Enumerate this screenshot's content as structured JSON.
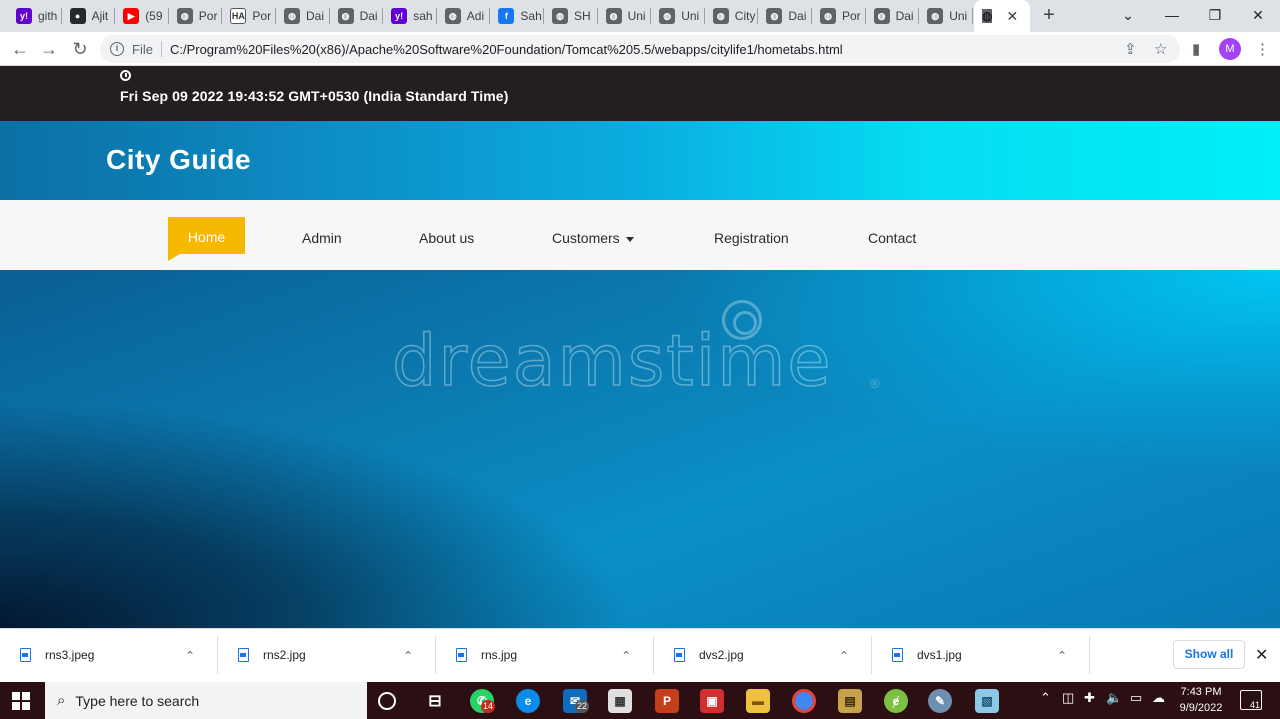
{
  "browser": {
    "tabs": [
      {
        "label": "gith",
        "icon": "yahoo-icon",
        "color": "#5f01d1",
        "glyph": "y!"
      },
      {
        "label": "Ajit",
        "icon": "github-icon",
        "color": "#24292e",
        "glyph": "●"
      },
      {
        "label": "(59",
        "icon": "youtube-icon",
        "color": "#ff0000",
        "glyph": "▶"
      },
      {
        "label": "Por",
        "icon": "globe-icon",
        "color": "#5f6368",
        "glyph": "◍"
      },
      {
        "label": "Por",
        "icon": "ha-icon",
        "color": "#ffffff",
        "glyph": "HA"
      },
      {
        "label": "Dai",
        "icon": "globe-icon",
        "color": "#5f6368",
        "glyph": "◍"
      },
      {
        "label": "Dai",
        "icon": "globe-icon",
        "color": "#5f6368",
        "glyph": "◍"
      },
      {
        "label": "sah",
        "icon": "yahoo-icon",
        "color": "#5f01d1",
        "glyph": "y!"
      },
      {
        "label": "Adi",
        "icon": "globe-icon",
        "color": "#5f6368",
        "glyph": "◍"
      },
      {
        "label": "Sah",
        "icon": "facebook-icon",
        "color": "#1877f2",
        "glyph": "f"
      },
      {
        "label": "SH",
        "icon": "globe-icon",
        "color": "#5f6368",
        "glyph": "◍"
      },
      {
        "label": "Uni",
        "icon": "globe-icon",
        "color": "#5f6368",
        "glyph": "◍"
      },
      {
        "label": "Uni",
        "icon": "globe-icon",
        "color": "#5f6368",
        "glyph": "◍"
      },
      {
        "label": "City",
        "icon": "globe-icon",
        "color": "#5f6368",
        "glyph": "◍"
      },
      {
        "label": "Dai",
        "icon": "globe-icon",
        "color": "#5f6368",
        "glyph": "◍"
      },
      {
        "label": "Por",
        "icon": "globe-icon",
        "color": "#5f6368",
        "glyph": "◍"
      },
      {
        "label": "Dai",
        "icon": "globe-icon",
        "color": "#5f6368",
        "glyph": "◍"
      },
      {
        "label": "Uni",
        "icon": "globe-icon",
        "color": "#5f6368",
        "glyph": "◍"
      }
    ],
    "active_tab_close": "✕",
    "new_tab": "+",
    "file_label": "File",
    "url": "C:/Program%20Files%20(x86)/Apache%20Software%20Foundation/Tomcat%205.5/webapps/citylife1/hometabs.html",
    "profile_initial": "M"
  },
  "page": {
    "datetime": "Fri Sep 09 2022 19:43:52 GMT+0530 (India Standard Time)",
    "brand": "City Guide",
    "nav": {
      "home": "Home",
      "admin": "Admin",
      "about": "About us",
      "customers": "Customers",
      "registration": "Registration",
      "contact": "Contact"
    },
    "watermark": "dreamstime",
    "watermark_reg": "®"
  },
  "downloads": {
    "files": [
      "rns3.jpeg",
      "rns2.jpg",
      "rns.jpg",
      "dvs2.jpg",
      "dvs1.jpg"
    ],
    "show_all": "Show all"
  },
  "taskbar": {
    "search_placeholder": "Type here to search",
    "whatsapp_badge": "14",
    "mail_badge": "22",
    "time": "7:43 PM",
    "date": "9/9/2022",
    "notifications": "41"
  },
  "colors": {
    "accent_nav": "#f6b900",
    "topbar": "#231f20",
    "header_start": "#0b6fa4",
    "header_end": "#00f0f8",
    "taskbar": "#2b0f12"
  }
}
